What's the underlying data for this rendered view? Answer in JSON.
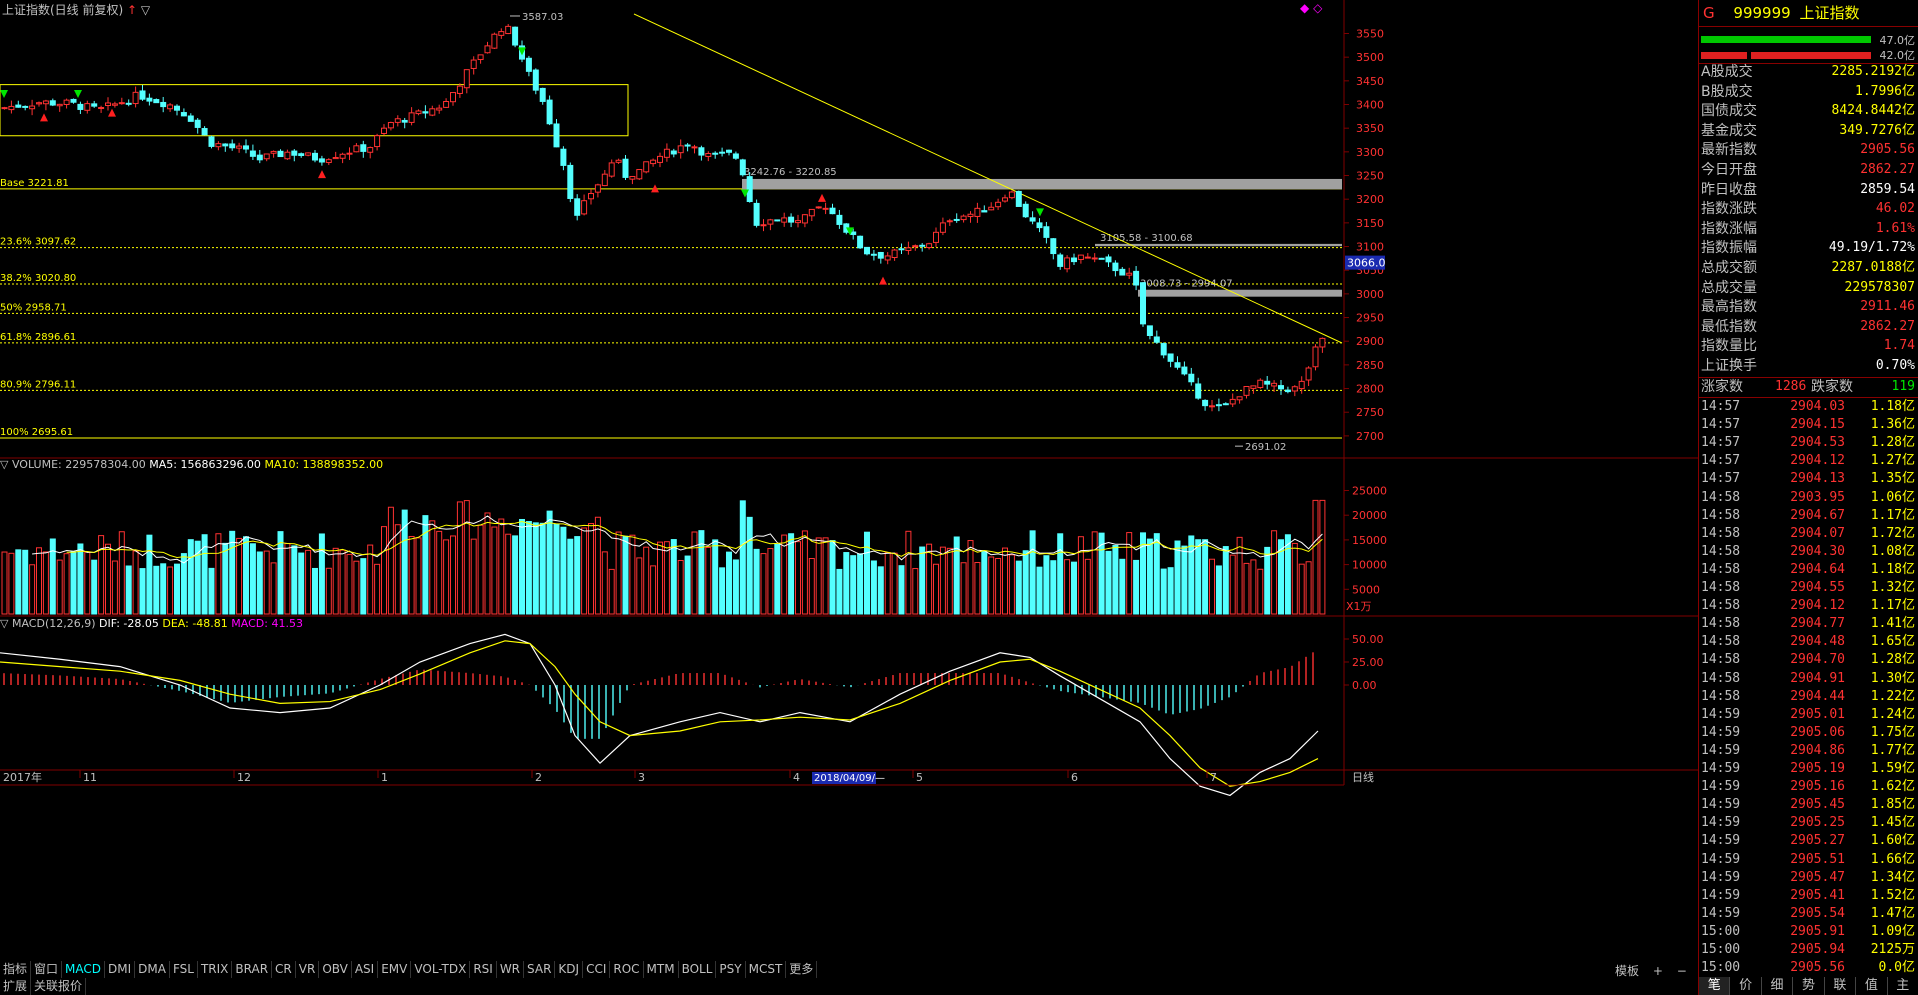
{
  "chart_title": "上证指数(日线 前复权)",
  "corner_icons": [
    "◆",
    "◇"
  ],
  "price_axis": [
    "3550",
    "3500",
    "3450",
    "3400",
    "3350",
    "3300",
    "3250",
    "3200",
    "3150",
    "3100",
    "3050",
    "3000",
    "2950",
    "2900",
    "2850",
    "2800",
    "2750",
    "2700"
  ],
  "volume_axis": [
    "25000",
    "20000",
    "15000",
    "10000",
    "5000"
  ],
  "volume_unit": "X1万",
  "macd_axis": [
    "50.00",
    "25.00",
    "0.00"
  ],
  "current_price_tag": "3066.0",
  "fib_labels": {
    "base": "Base 3221.81",
    "f236": "23.6% 3097.62",
    "f382": "38.2% 3020.80",
    "f50": "50% 2958.71",
    "f618": "61.8% 2896.61",
    "f809": "80.9% 2796.11",
    "f100": "100% 2695.61"
  },
  "annotations": {
    "high": "3587.03",
    "low": "2691.02",
    "zone1": "3242.76 - 3220.85",
    "zone2": "3105.58 - 3100.68",
    "zone3": "3008.73 - 2994.07"
  },
  "volume_header": {
    "name": "VOLUME:",
    "value": "229578304.00",
    "ma5": "MA5: 156863296.00",
    "ma10": "MA10: 138898352.00"
  },
  "macd_header": {
    "name": "MACD(12,26,9)",
    "dif": "DIF: -28.05",
    "dea": "DEA: -48.81",
    "macd": "MACD: 41.53"
  },
  "date_axis": {
    "year": "2017年",
    "months": [
      "11",
      "12",
      "1",
      "2",
      "3",
      "4",
      "5",
      "6",
      "7"
    ],
    "cursor_date": "2018/04/09/—",
    "period": "日线"
  },
  "indicator_tabs": [
    "指标",
    "窗口",
    "MACD",
    "DMI",
    "DMA",
    "FSL",
    "TRIX",
    "BRAR",
    "CR",
    "VR",
    "OBV",
    "ASI",
    "EMV",
    "VOL-TDX",
    "RSI",
    "WR",
    "SAR",
    "KDJ",
    "CCI",
    "ROC",
    "MTM",
    "BOLL",
    "PSY",
    "MCST",
    "更多"
  ],
  "bottom_row": [
    "扩展",
    "关联报价"
  ],
  "template_label": "模板",
  "quote": {
    "flag": "G",
    "code": "999999",
    "name": "上证指数",
    "bar1_label": "47.0亿",
    "bar2_label": "42.0亿",
    "fields": [
      {
        "label": "A股成交",
        "value": "2285.2192亿",
        "color": "yellow"
      },
      {
        "label": "B股成交",
        "value": "1.7996亿",
        "color": "yellow"
      },
      {
        "label": "国债成交",
        "value": "8424.8442亿",
        "color": "yellow"
      },
      {
        "label": "基金成交",
        "value": "349.7276亿",
        "color": "yellow"
      },
      {
        "label": "最新指数",
        "value": "2905.56",
        "color": "red"
      },
      {
        "label": "今日开盘",
        "value": "2862.27",
        "color": "red"
      },
      {
        "label": "昨日收盘",
        "value": "2859.54",
        "color": "white"
      },
      {
        "label": "指数涨跌",
        "value": "46.02",
        "color": "red"
      },
      {
        "label": "指数涨幅",
        "value": "1.61%",
        "color": "red"
      },
      {
        "label": "指数振幅",
        "value": "49.19/1.72%",
        "color": "white"
      },
      {
        "label": "总成交额",
        "value": "2287.0188亿",
        "color": "yellow"
      },
      {
        "label": "总成交量",
        "value": "229578307",
        "color": "yellow"
      },
      {
        "label": "最高指数",
        "value": "2911.46",
        "color": "red"
      },
      {
        "label": "最低指数",
        "value": "2862.27",
        "color": "red"
      },
      {
        "label": "指数量比",
        "value": "1.74",
        "color": "red"
      },
      {
        "label": "上证换手",
        "value": "0.70%",
        "color": "white"
      }
    ],
    "rise_label": "涨家数",
    "rise_value": "1286",
    "fall_label": "跌家数",
    "fall_value": "119"
  },
  "ticks": [
    [
      "14:57",
      "2904.03",
      "1.18亿"
    ],
    [
      "14:57",
      "2904.15",
      "1.36亿"
    ],
    [
      "14:57",
      "2904.53",
      "1.28亿"
    ],
    [
      "14:57",
      "2904.12",
      "1.27亿"
    ],
    [
      "14:57",
      "2904.13",
      "1.35亿"
    ],
    [
      "14:58",
      "2903.95",
      "1.06亿"
    ],
    [
      "14:58",
      "2904.67",
      "1.17亿"
    ],
    [
      "14:58",
      "2904.07",
      "1.72亿"
    ],
    [
      "14:58",
      "2904.30",
      "1.08亿"
    ],
    [
      "14:58",
      "2904.64",
      "1.18亿"
    ],
    [
      "14:58",
      "2904.55",
      "1.32亿"
    ],
    [
      "14:58",
      "2904.12",
      "1.17亿"
    ],
    [
      "14:58",
      "2904.77",
      "1.41亿"
    ],
    [
      "14:58",
      "2904.48",
      "1.65亿"
    ],
    [
      "14:58",
      "2904.70",
      "1.28亿"
    ],
    [
      "14:58",
      "2904.91",
      "1.30亿"
    ],
    [
      "14:58",
      "2904.44",
      "1.22亿"
    ],
    [
      "14:59",
      "2905.01",
      "1.24亿"
    ],
    [
      "14:59",
      "2905.06",
      "1.75亿"
    ],
    [
      "14:59",
      "2904.86",
      "1.77亿"
    ],
    [
      "14:59",
      "2905.19",
      "1.59亿"
    ],
    [
      "14:59",
      "2905.16",
      "1.62亿"
    ],
    [
      "14:59",
      "2905.45",
      "1.85亿"
    ],
    [
      "14:59",
      "2905.25",
      "1.45亿"
    ],
    [
      "14:59",
      "2905.27",
      "1.60亿"
    ],
    [
      "14:59",
      "2905.51",
      "1.66亿"
    ],
    [
      "14:59",
      "2905.47",
      "1.34亿"
    ],
    [
      "14:59",
      "2905.41",
      "1.52亿"
    ],
    [
      "14:59",
      "2905.54",
      "1.47亿"
    ],
    [
      "15:00",
      "2905.91",
      "1.09亿"
    ],
    [
      "15:00",
      "2905.94",
      "2125万"
    ],
    [
      "15:00",
      "2905.56",
      "0.0亿"
    ]
  ],
  "bottom_tabs": [
    "笔",
    "价",
    "细",
    "势",
    "联",
    "值",
    "主"
  ],
  "colors": {
    "up": "#ff3232",
    "down": "#54ffff",
    "fib": "#ffff00",
    "trend": "#ffff00",
    "zone": "#a0a0a0",
    "axis": "#800000"
  }
}
